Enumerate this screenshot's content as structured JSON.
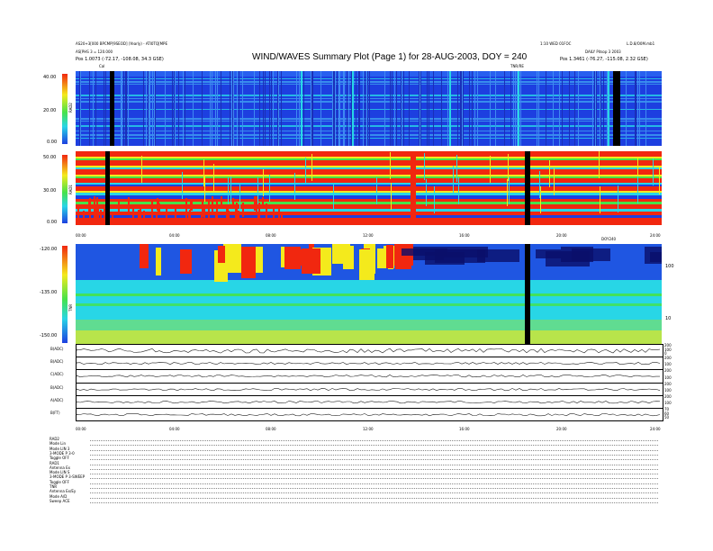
{
  "header": {
    "left_line1": "AS20+3[000 BPCMP[9SEOD] (Yearly) - ATI0TQ[MPE",
    "left_line2": "AS[PHS 3 = 120.000",
    "left_pos": "Pos   1.0073 (-72.17, -108.08, 34.3 GSE)",
    "right_line1": "1:10 WED 01FOC",
    "right_id": "L.D.8/O0M.mb1",
    "right_line2": "DAILY Pitsop 3 2003",
    "right_pos": "Pos   1.3461 (-76.27, -115.08, 2.32 GSE)",
    "title": "WIND/WAVES Summary Plot (Page 1) for 28-AUG-2003, DOY = 240",
    "marker_cal": "Cal",
    "marker_right": "TNR/RE"
  },
  "colors": {
    "bg_blue": "#1d3fe0",
    "cyan": "#28d6e6",
    "green": "#46e24a",
    "yellow": "#f4ea1c",
    "red": "#f1270f",
    "black": "#000000"
  },
  "chart_data": [
    {
      "type": "heatmap",
      "name": "RAD2",
      "ylabel": "RAD2",
      "yticks": [
        "40.00",
        "20.00",
        "0.00"
      ],
      "ylim": [
        0,
        40
      ],
      "xlim": [
        0,
        24
      ],
      "data_gaps_hours": [
        [
          1.4,
          1.6
        ],
        [
          22.0,
          22.3
        ]
      ],
      "storms_hours": [
        9.2,
        11.3,
        15.3,
        18.1,
        21.8
      ]
    },
    {
      "type": "heatmap",
      "name": "RAD1",
      "ylabel": "RAD1",
      "yticks": [
        "50.00",
        "30.00",
        "0.00"
      ],
      "ylim": [
        0,
        50
      ],
      "xlim": [
        0,
        24
      ],
      "xticks": [
        "00:00",
        "04:00",
        "08:00",
        "12:00",
        "16:00",
        "20:00",
        "24:00"
      ],
      "data_gaps_hours": [
        [
          1.2,
          1.4
        ],
        [
          18.4,
          18.6
        ]
      ],
      "inset_label": "DOY240"
    },
    {
      "type": "heatmap",
      "name": "TNR",
      "ylabel": "TNR",
      "yticks": [
        "-120.00",
        "-135.00",
        "-150.00"
      ],
      "ylim": [
        -150,
        -120
      ],
      "right_ticks": [
        "100",
        "10"
      ],
      "xlim": [
        0,
        24
      ],
      "data_gaps_hours": [
        [
          18.4,
          18.6
        ]
      ]
    },
    {
      "type": "line",
      "name": "waveform traces",
      "panels": [
        {
          "label": "B(ADC)",
          "right": [
            "200",
            "100",
            "0"
          ]
        },
        {
          "label": "B(ADC)",
          "right": [
            "200",
            "100"
          ]
        },
        {
          "label": "C(ADC)",
          "right": [
            "200",
            "100"
          ]
        },
        {
          "label": "B(ADC)",
          "right": [
            "200",
            "100"
          ]
        },
        {
          "label": "A(ADC)",
          "right": [
            "200",
            "100"
          ]
        },
        {
          "label": "B(FT)",
          "right": [
            "70",
            "60",
            "50"
          ]
        }
      ],
      "xticks": [
        "00:00",
        "04:00",
        "08:00",
        "12:00",
        "16:00",
        "20:00",
        "24:00"
      ]
    }
  ],
  "footer": {
    "sections": [
      {
        "lines": [
          "RAD2",
          "Mode    Lin",
          "Mode   LIN 3",
          "3-MODE P  3-0",
          "Toggle    OFF"
        ]
      },
      {
        "lines": [
          "RAD1",
          "Antenna     Ex",
          "Mode   LIN S",
          "3-MODE P  3-SWEEP",
          "Toggle    OFF"
        ]
      },
      {
        "lines": [
          "TNR",
          "Antenna  Ex/Ey",
          "Mode     A/D",
          "Sweep    ACE"
        ]
      }
    ]
  }
}
